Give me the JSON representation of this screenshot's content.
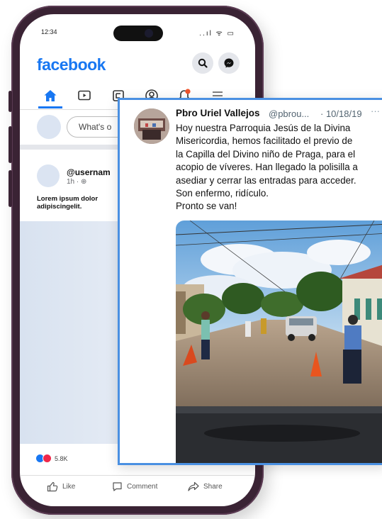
{
  "phone": {
    "status_time": "12:34",
    "status_icons": "..ıl ᯤ ▭"
  },
  "facebook": {
    "logo": "facebook",
    "composer_placeholder": "What's o",
    "post": {
      "username": "@usernam",
      "meta": "1h · ⊕",
      "text_line1": "Lorem ipsum dolor",
      "text_line2": "adipiscingelit."
    },
    "reactions_count": "5.8K",
    "actions": {
      "like": "Like",
      "comment": "Comment",
      "share": "Share"
    },
    "colors": {
      "brand": "#1877f2"
    }
  },
  "tweet": {
    "name": "Pbro Uriel Vallejos",
    "handle": "@pbrou...",
    "date": "· 10/18/19",
    "more": "···",
    "lines": [
      "Hoy nuestra Parroquia Jesús de la Divina",
      "Misericordia, hemos facilitado el previo de",
      "la Capilla del Divino niño de Praga, para el",
      "acopio de víveres. Han llegado la polisilla a",
      "asediar y cerrar las entradas para acceder.",
      "Son enfermo, ridículo.",
      "Pronto se van!"
    ],
    "border_color": "#4a90e2"
  }
}
